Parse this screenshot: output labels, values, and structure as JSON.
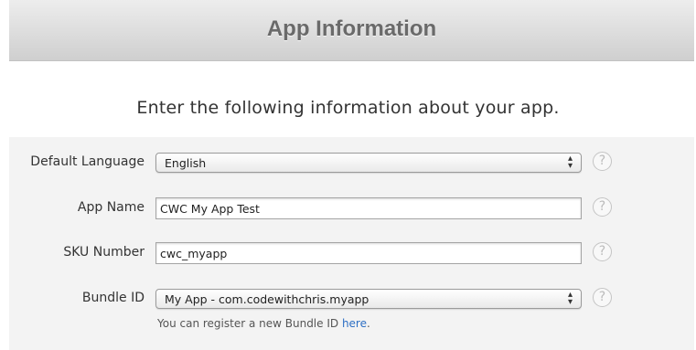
{
  "header": {
    "title": "App Information"
  },
  "intro_text": "Enter the following information about your app.",
  "form": {
    "default_language": {
      "label": "Default Language",
      "value": "English",
      "help": "?"
    },
    "app_name": {
      "label": "App Name",
      "value": "CWC My App Test",
      "help": "?"
    },
    "sku_number": {
      "label": "SKU Number",
      "value": "cwc_myapp",
      "help": "?"
    },
    "bundle_id": {
      "label": "Bundle ID",
      "value": "My App - com.codewithchris.myapp",
      "help": "?",
      "hint_prefix": "You can register a new Bundle ID ",
      "hint_link": "here",
      "hint_suffix": "."
    }
  },
  "colors": {
    "link": "#2d6fc4",
    "panel_background": "#f3f3f3",
    "header_text": "#6a6a6a"
  }
}
